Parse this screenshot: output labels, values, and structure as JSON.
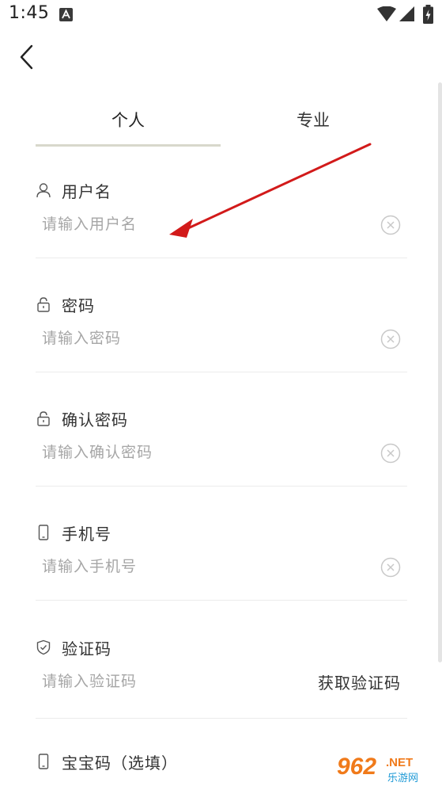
{
  "status_bar": {
    "time": "1:45",
    "notification_icon": "a-box-icon",
    "icons": [
      "wifi-icon",
      "signal-icon",
      "battery-charging-icon"
    ]
  },
  "tabs": [
    {
      "label": "个人",
      "selected": true
    },
    {
      "label": "专业",
      "selected": false
    }
  ],
  "fields": {
    "username": {
      "label": "用户名",
      "placeholder": "请输入用户名",
      "value": "",
      "icon": "user-icon"
    },
    "password": {
      "label": "密码",
      "placeholder": "请输入密码",
      "value": "",
      "icon": "lock-icon"
    },
    "confirm_password": {
      "label": "确认密码",
      "placeholder": "请输入确认密码",
      "value": "",
      "icon": "lock-icon"
    },
    "phone": {
      "label": "手机号",
      "placeholder": "请输入手机号",
      "value": "",
      "icon": "phone-icon"
    },
    "verification_code": {
      "label": "验证码",
      "placeholder": "请输入验证码",
      "value": "",
      "icon": "shield-icon",
      "action_label": "获取验证码"
    },
    "baby_code": {
      "label": "宝宝码（选填）",
      "icon": "phone-icon"
    }
  },
  "colors": {
    "annotation_arrow": "#d21a1a",
    "tab_indicator": "#d8d8cc",
    "watermark_orange": "#f07a1a"
  },
  "watermark": {
    "brand": "962",
    "suffix": ".NET",
    "subtitle": "乐游网"
  }
}
